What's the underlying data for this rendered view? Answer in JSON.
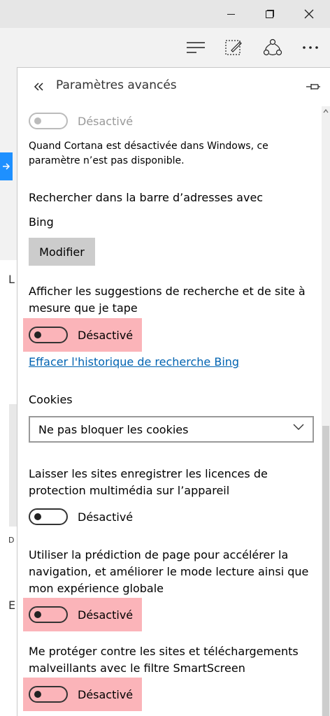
{
  "window": {
    "minimize_icon": "minimize-icon",
    "maximize_icon": "restore-icon",
    "close_icon": "close-icon"
  },
  "toolbar": {
    "hub_icon": "hub-icon",
    "note_icon": "web-note-icon",
    "share_icon": "share-icon",
    "more_icon": "more-icon"
  },
  "panel": {
    "title": "Paramètres avancés",
    "back_icon": "double-chevron-left-icon",
    "pin_icon": "pin-icon",
    "cortana_toggle_label": "Désactivé",
    "cortana_note": "Quand Cortana est désactivée dans Windows, ce paramètre n’est pas disponible.",
    "search_in_address_bar_label": "Rechercher dans la barre d’adresses avec",
    "search_engine": "Bing",
    "change_button": "Modifier",
    "suggestions_label": "Afficher les suggestions de recherche et de site à mesure que je tape",
    "suggestions_toggle_label": "Désactivé",
    "clear_history_link": "Effacer l'historique de recherche Bing",
    "cookies_label": "Cookies",
    "cookies_value": "Ne pas bloquer les cookies",
    "media_licenses_label": "Laisser les sites enregistrer les licences de protection multimédia sur l’appareil",
    "media_licenses_toggle_label": "Désactivé",
    "page_prediction_label": "Utiliser la prédiction de page pour accélérer la navigation, et améliorer le mode lecture ainsi que mon expérience globale",
    "page_prediction_toggle_label": "Désactivé",
    "smartscreen_label": "Me protéger contre les sites et téléchargements malveillants avec le filtre SmartScreen",
    "smartscreen_toggle_label": "Désactivé"
  },
  "background": {
    "char_1": "L",
    "char_2": "D",
    "char_3": "E"
  },
  "colors": {
    "highlight": "#fbb4b9",
    "link": "#0063b1",
    "accent_blue": "#1e90ff"
  }
}
